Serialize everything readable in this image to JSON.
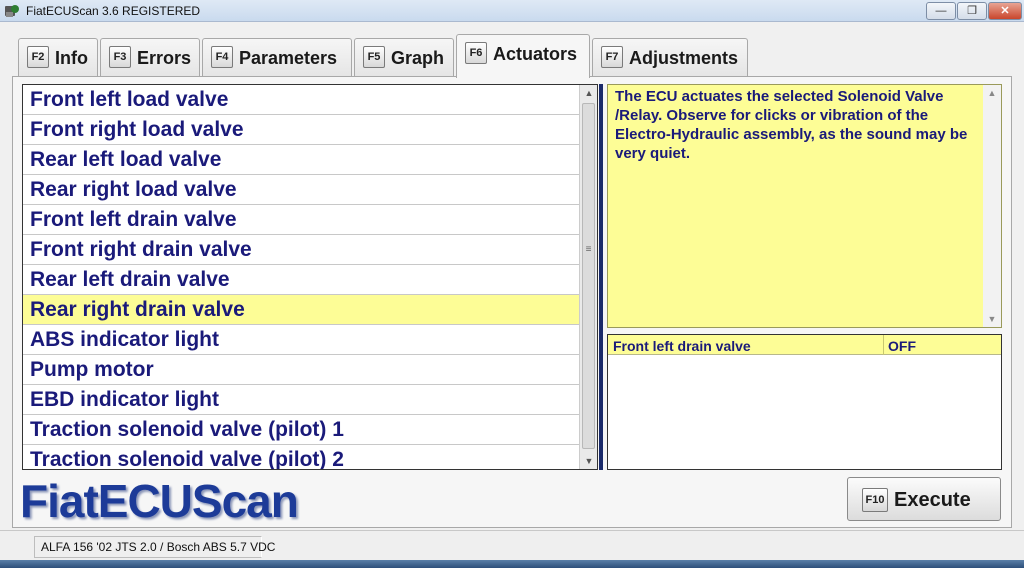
{
  "window": {
    "title": "FiatECUScan 3.6 REGISTERED"
  },
  "tabs": [
    {
      "key": "F2",
      "label": "Info"
    },
    {
      "key": "F3",
      "label": "Errors"
    },
    {
      "key": "F4",
      "label": "Parameters"
    },
    {
      "key": "F5",
      "label": "Graph"
    },
    {
      "key": "F6",
      "label": "Actuators"
    },
    {
      "key": "F7",
      "label": "Adjustments"
    }
  ],
  "active_tab": "Actuators",
  "actuators": {
    "items": [
      "Front left load valve",
      "Front right load valve",
      "Rear left load valve",
      "Rear right load valve",
      "Front left drain valve",
      "Front right drain valve",
      "Rear left drain valve",
      "Rear right drain valve",
      "ABS indicator light",
      "Pump motor",
      "EBD indicator light",
      "Traction solenoid valve (pilot) 1",
      "Traction solenoid valve (pilot) 2"
    ],
    "selected": "Rear right drain valve"
  },
  "description": "The ECU actuates the selected Solenoid Valve /Relay. Observe for clicks or vibration of the Electro-Hydraulic assembly, as the sound may be very quiet.",
  "status": {
    "name": "Front left drain valve",
    "value": "OFF"
  },
  "logo": "FiatECUScan",
  "execute": {
    "key": "F10",
    "label": "Execute"
  },
  "statusbar": {
    "vehicle": "ALFA 156 '02 JTS 2.0 / Bosch ABS 5.7 VDC"
  },
  "colors": {
    "highlight": "#fdfd96",
    "text": "#1a1a7a",
    "logo": "#1d3b98"
  }
}
